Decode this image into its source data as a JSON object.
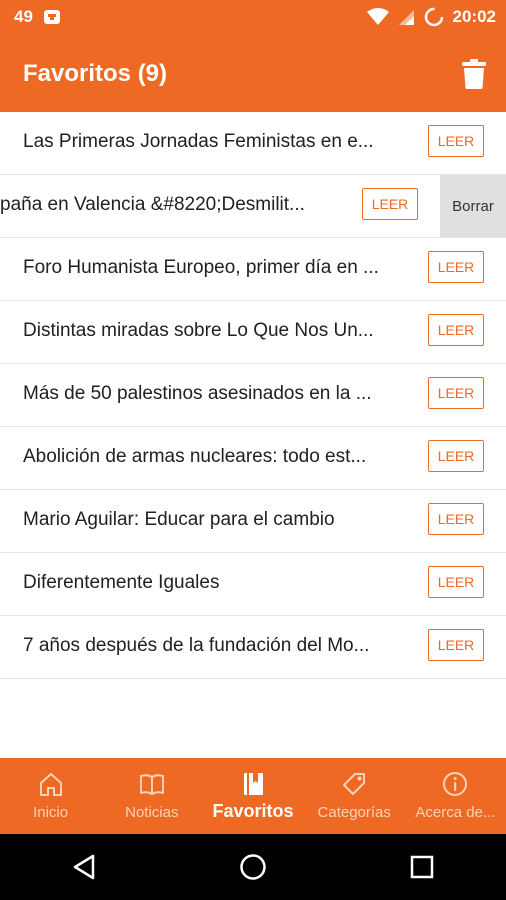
{
  "status_bar": {
    "notification_count": "49",
    "time": "20:02"
  },
  "app_bar": {
    "title": "Favoritos (9)"
  },
  "list": {
    "items": [
      {
        "title": "Las Primeras Jornadas Feministas en e...",
        "button": "LEER"
      },
      {
        "title": "paña en Valencia &#8220;Desmilit...",
        "button": "LEER",
        "swipe_action": "Borrar"
      },
      {
        "title": "Foro Humanista Europeo, primer día en ...",
        "button": "LEER"
      },
      {
        "title": "Distintas miradas sobre Lo Que Nos Un...",
        "button": "LEER"
      },
      {
        "title": "Más de 50 palestinos asesinados en la ...",
        "button": "LEER"
      },
      {
        "title": "Abolición de armas nucleares: todo est...",
        "button": "LEER"
      },
      {
        "title": "Mario Aguilar: Educar para el cambio",
        "button": "LEER"
      },
      {
        "title": "Diferentemente Iguales",
        "button": "LEER"
      },
      {
        "title": "7 años después de la fundación del Mo...",
        "button": "LEER"
      }
    ]
  },
  "bottom_nav": {
    "items": [
      {
        "label": "Inicio",
        "icon": "home-icon"
      },
      {
        "label": "Noticias",
        "icon": "book-icon"
      },
      {
        "label": "Favoritos",
        "icon": "bookmark-book-icon",
        "active": true
      },
      {
        "label": "Categorías",
        "icon": "tag-icon"
      },
      {
        "label": "Acerca de...",
        "icon": "info-icon"
      }
    ]
  },
  "colors": {
    "primary": "#EE6A24",
    "inactive_nav": "#FCD2B8",
    "swipe_bg": "#E0E0E0"
  }
}
